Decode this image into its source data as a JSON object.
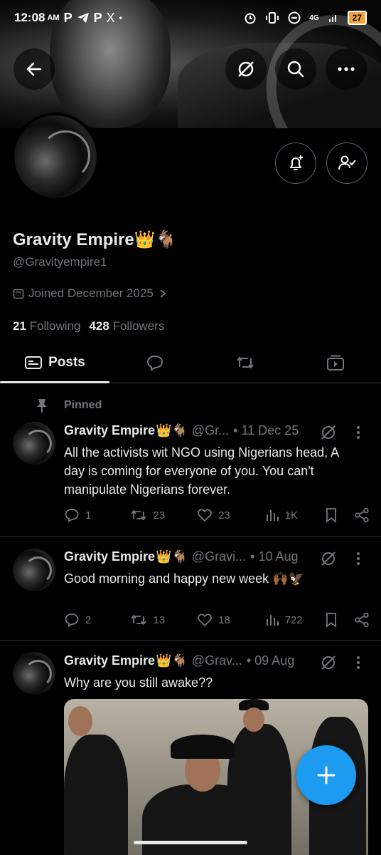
{
  "status_bar": {
    "time": "12:08",
    "ampm": "AM",
    "app_icons": [
      "P",
      "telegram-icon",
      "P",
      "X"
    ],
    "dot": "•",
    "network": "4G",
    "battery": "27"
  },
  "profile": {
    "name": "Gravity Empire",
    "name_emoji": "👑🐐",
    "handle": "@Gravityempire1",
    "joined": "Joined December 2025",
    "following_count": "21",
    "following_label": "Following",
    "followers_count": "428",
    "followers_label": "Followers"
  },
  "tabs": [
    {
      "label": "Posts",
      "icon": "posts-icon",
      "active": true
    },
    {
      "label": "",
      "icon": "replies-icon",
      "active": false
    },
    {
      "label": "",
      "icon": "reposts-icon",
      "active": false
    },
    {
      "label": "",
      "icon": "media-icon",
      "active": false
    }
  ],
  "pinned_label": "Pinned",
  "posts": [
    {
      "name": "Gravity Empire",
      "emoji": "👑🐐",
      "handle": "@Gr...",
      "dot": "•",
      "date": "11 Dec 25",
      "text": "All the activists wit NGO using Nigerians head, A day is coming for everyone of you. You can't manipulate Nigerians forever.",
      "replies": "1",
      "reposts": "23",
      "likes": "23",
      "views": "1K"
    },
    {
      "name": "Gravity Empire",
      "emoji": "👑🐐",
      "handle": "@Gravi...",
      "dot": "•",
      "date": "10 Aug",
      "text": "Good morning and happy new week 🙌🏾🦅",
      "replies": "2",
      "reposts": "13",
      "likes": "18",
      "views": "722"
    },
    {
      "name": "Gravity Empire",
      "emoji": "👑🐐",
      "handle": "@Grav...",
      "dot": "•",
      "date": "09 Aug",
      "text": "Why are you still awake??"
    }
  ],
  "colors": {
    "accent": "#1d9bf0",
    "muted": "#71767b",
    "text": "#e7e9ea",
    "divider": "#2f3336"
  }
}
